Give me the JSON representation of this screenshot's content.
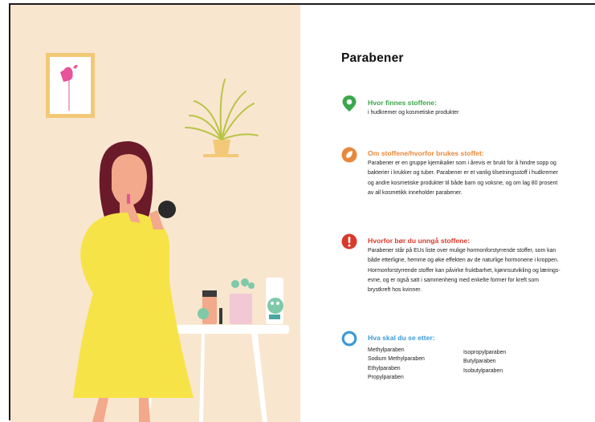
{
  "page": {
    "title": "Parabener"
  },
  "sections": [
    {
      "icon": "location-pin-icon",
      "color": "#3aa84a",
      "heading": "Hvor finnes stoffene:",
      "body": "i hudkremer og kosmetiske produkter"
    },
    {
      "icon": "leaf-badge-icon",
      "color": "#e8883a",
      "heading": "Om stoffene/hvorfor brukes stoffet:",
      "body": "Parabener er en gruppe kjemikalier som i årevis er brukt for å hindre sopp og bakterier i krukker og tuber. Parabener er et vanlig tilsetningsstoff i hudkremer og andre kosmetiske produkter til både barn og voksne, og om lag 80 prosent av all kosmetikk inneholder parabener."
    },
    {
      "icon": "warning-icon",
      "color": "#d9392b",
      "heading": "Hvorfor bør du unngå stoffene:",
      "body": "Parabener står på EUs liste over mulige hormonforstyrrende stoffer, som kan både etterligne, hemme og øke effekten av de naturlige hormonene i kroppen. Hormonforstyrrende stoffer kan påvirke fruktbarhet, kjønnsutvikling og lærings-evne, og er også satt i sammenheng med enkelte former for kreft som brystkreft hos kvinner."
    },
    {
      "icon": "ring-icon",
      "color": "#3a9ad9",
      "heading": "Hva skal du se etter:",
      "list_left": [
        "Methylparaben",
        "Sodium Methylparaben",
        "Ethylparaben",
        "Propylparaben"
      ],
      "list_right": [
        "Isopropylparaben",
        "Butylparaben",
        "Isobutylparaben"
      ]
    }
  ],
  "illustration": {
    "wall_color": "#f9e6cf",
    "dress_color": "#f6e347",
    "accent_pink": "#e8529a"
  }
}
